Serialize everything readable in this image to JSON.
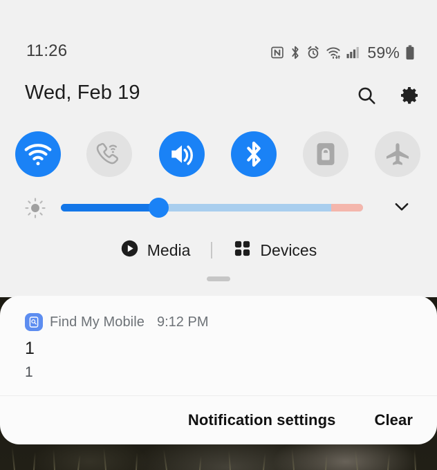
{
  "statusbar": {
    "time": "11:26",
    "battery_percent": "59%",
    "icons": [
      "nfc-icon",
      "bluetooth-icon",
      "alarm-icon",
      "wifi-icon",
      "cellular-signal-icon",
      "battery-icon"
    ]
  },
  "header": {
    "date": "Wed, Feb 19",
    "search_icon": "search-icon",
    "settings_icon": "gear-icon"
  },
  "quick_toggles": [
    {
      "name": "wifi",
      "label": "Wi-Fi",
      "icon": "wifi-icon",
      "state": "on"
    },
    {
      "name": "wifi-calling",
      "label": "Wi-Fi calling",
      "icon": "phone-wifi-icon",
      "state": "off"
    },
    {
      "name": "sound",
      "label": "Sound",
      "icon": "speaker-icon",
      "state": "on"
    },
    {
      "name": "bluetooth",
      "label": "Bluetooth",
      "icon": "bluetooth-icon",
      "state": "on"
    },
    {
      "name": "sim-card-lock",
      "label": "SIM card lock",
      "icon": "sim-lock-icon",
      "state": "off"
    },
    {
      "name": "airplane-mode",
      "label": "Airplane mode",
      "icon": "airplane-icon",
      "state": "off"
    }
  ],
  "brightness": {
    "icon": "brightness-sun-icon",
    "value_percent": 34,
    "expand_icon": "chevron-down-icon",
    "colors": {
      "fill": "#1376e8",
      "track": "#a9ceee",
      "extra_zone": "#f4b6ac",
      "knob": "#1a82f6"
    }
  },
  "media_devices": {
    "media_label": "Media",
    "media_icon": "play-circle-icon",
    "devices_label": "Devices",
    "devices_icon": "grid-squares-icon"
  },
  "notification": {
    "app_icon": "find-my-mobile-icon",
    "app_name": "Find My Mobile",
    "time": "9:12 PM",
    "title": "1",
    "text": "1"
  },
  "notification_actions": {
    "settings_label": "Notification settings",
    "clear_label": "Clear"
  },
  "theme": {
    "panel_bg": "#f1f1f1",
    "card_bg": "#fbfbfb",
    "accent": "#1a82f6",
    "toggle_off_bg": "#e2e2e2"
  }
}
